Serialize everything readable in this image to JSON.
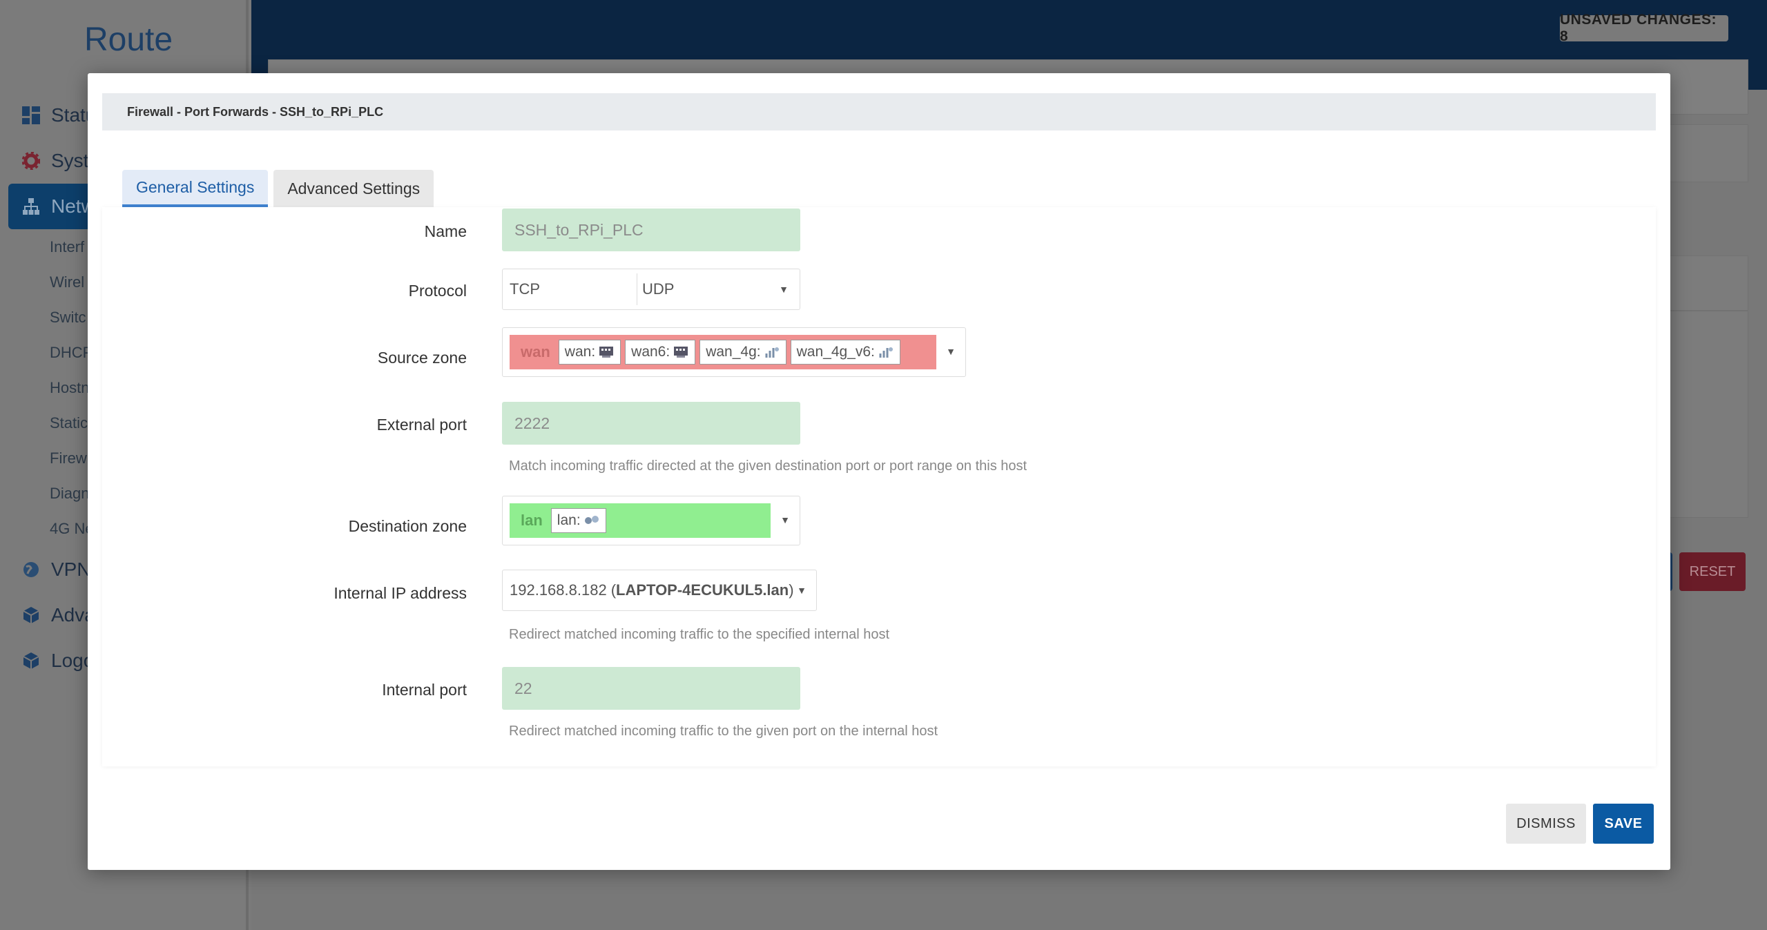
{
  "background": {
    "brand": "Route",
    "unsaved_changes": "UNSAVED CHANGES: 8",
    "menu": [
      {
        "label": "Statu",
        "icon": "dashboard-icon"
      },
      {
        "label": "Syste",
        "icon": "gear-icon"
      },
      {
        "label": "Netw",
        "icon": "network-icon"
      },
      {
        "label": "VPN",
        "icon": "globe-icon"
      },
      {
        "label": "Adva",
        "icon": "cube-icon"
      },
      {
        "label": "Logo",
        "icon": "cube-icon"
      }
    ],
    "submenu": [
      "Interf",
      "Wirel",
      "Switc",
      "DHCP",
      "Hostn",
      "Static",
      "Firew",
      "Diagn",
      "4G Ne"
    ],
    "reset_label": "RESET"
  },
  "modal": {
    "title": "Firewall - Port Forwards - SSH_to_RPi_PLC",
    "tabs": [
      {
        "label": "General Settings",
        "active": true
      },
      {
        "label": "Advanced Settings",
        "active": false
      }
    ],
    "fields": {
      "name": {
        "label": "Name",
        "value": "SSH_to_RPi_PLC"
      },
      "protocol": {
        "label": "Protocol",
        "values": [
          "TCP",
          "UDP"
        ]
      },
      "source_zone": {
        "label": "Source zone",
        "zone": "wan",
        "zone_color": "#f09090",
        "interfaces": [
          "wan:",
          "wan6:",
          "wan_4g:",
          "wan_4g_v6:"
        ]
      },
      "external_port": {
        "label": "External port",
        "value": "2222",
        "hint": "Match incoming traffic directed at the given destination port or port range on this host"
      },
      "destination_zone": {
        "label": "Destination zone",
        "zone": "lan",
        "zone_color": "#90ee90",
        "interfaces": [
          "lan:"
        ]
      },
      "internal_ip": {
        "label": "Internal IP address",
        "ip": "192.168.8.182",
        "host_open": "(",
        "host": "LAPTOP-4ECUKUL5.lan",
        "host_close": ")",
        "hint": "Redirect matched incoming traffic to the specified internal host"
      },
      "internal_port": {
        "label": "Internal port",
        "value": "22",
        "hint": "Redirect matched incoming traffic to the given port on the internal host"
      }
    },
    "buttons": {
      "dismiss": "DISMISS",
      "save": "SAVE"
    }
  },
  "colors": {
    "primary": "#0b5aa3",
    "valid_field": "#cde9d3",
    "tab_accent": "#3f82cf"
  }
}
